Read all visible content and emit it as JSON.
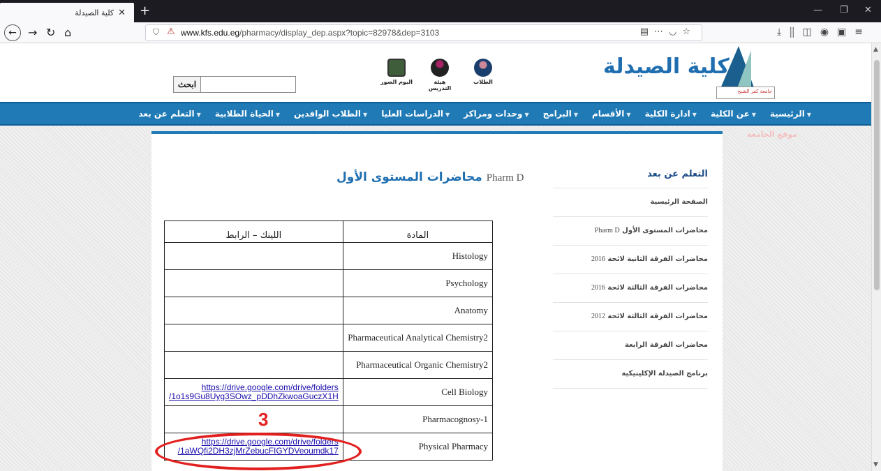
{
  "browser": {
    "tab_title": "كلية الصيدلة",
    "tab_close": "✕",
    "new_tab": "+",
    "url_host": "www.kfs.edu.eg",
    "url_path": "/pharmacy/display_dep.aspx?topic=82978&dep=3103"
  },
  "header": {
    "logo_text": "كلية الصيدلة",
    "logo_badge": "جامعة كفر الشيخ",
    "icons": [
      {
        "label": "البوم الصور",
        "icon": "photo-album-icon"
      },
      {
        "label": "هيئة التدريس",
        "icon": "faculty-staff-icon"
      },
      {
        "label": "الطلاب",
        "icon": "students-icon"
      }
    ],
    "search_button": "ابحث",
    "search_value": ""
  },
  "nav": {
    "items": [
      "الرئيسية",
      "عن الكلية",
      "ادارة الكلية",
      "الأقسام",
      "البرامج",
      "وحدات ومراكز",
      "الدراسات العليا",
      "الطلاب الوافدين",
      "الحياة الطلابية",
      "التعلم عن بعد"
    ],
    "overflow_item": "موقع الجامعة"
  },
  "page": {
    "title_latin": "Pharm D",
    "title_arabic": "محاضرات المستوى الأول"
  },
  "sidebar": {
    "heading": "التعلم عن بعد",
    "items": [
      {
        "arabic": "الصفحة الرئيسية",
        "latin": ""
      },
      {
        "arabic": "محاضرات المستوى الأول",
        "latin": "Pharm D"
      },
      {
        "arabic": "محاضرات الفرقة الثانية لائحة",
        "latin": "2016"
      },
      {
        "arabic": "محاضرات الفرقة الثالثة لائحة",
        "latin": "2016"
      },
      {
        "arabic": "محاضرات الفرقة الثالثة لائحة",
        "latin": "2012"
      },
      {
        "arabic": "محاضرات الفرقة الرابعة",
        "latin": ""
      },
      {
        "arabic": "برنامج الصيدلة الإكلينيكية",
        "latin": ""
      }
    ]
  },
  "table": {
    "headers": {
      "subject": "المادة",
      "link": "اللينك – الرابط"
    },
    "rows": [
      {
        "subject": "Histology",
        "link1": "",
        "link2": ""
      },
      {
        "subject": "Psychology",
        "link1": "",
        "link2": ""
      },
      {
        "subject": "Anatomy",
        "link1": "",
        "link2": ""
      },
      {
        "subject": "Pharmaceutical  Analytical Chemistry2",
        "link1": "",
        "link2": ""
      },
      {
        "subject": "Pharmaceutical  Organic Chemistry2",
        "link1": "",
        "link2": ""
      },
      {
        "subject": "Cell Biology",
        "link1": "https://drive.google.com/drive/folders",
        "link2": "/1o1s9Gu8Uyg3SOwz_pDDhZkwoaGuczX1H"
      },
      {
        "subject": "Pharmacognosy-1",
        "link1": "",
        "link2": ""
      },
      {
        "subject": "Physical Pharmacy",
        "link1": "https://drive.google.com/drive/folders",
        "link2": "/1aWQfi2DH3zjMrZebucFIGYDVeoumdk17"
      }
    ]
  },
  "annotation": {
    "number": "3",
    "color": "#e2201f"
  },
  "colors": {
    "brand_blue": "#1f7ab6",
    "title_blue": "#1f6eb0",
    "link": "#1a0dab"
  }
}
